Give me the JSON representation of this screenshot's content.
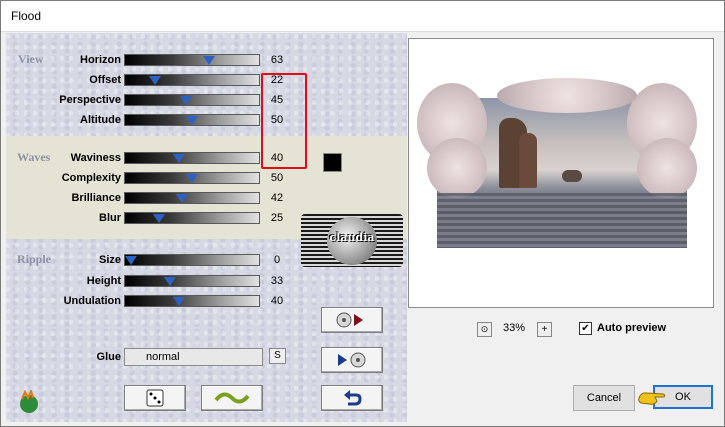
{
  "window": {
    "title": "Flood"
  },
  "sections": {
    "view": "View",
    "waves": "Waves",
    "ripple": "Ripple"
  },
  "view": [
    {
      "label": "Horizon",
      "value": "63"
    },
    {
      "label": "Offset",
      "value": "22"
    },
    {
      "label": "Perspective",
      "value": "45"
    },
    {
      "label": "Altitude",
      "value": "50"
    }
  ],
  "waves": [
    {
      "label": "Waviness",
      "value": "40"
    },
    {
      "label": "Complexity",
      "value": "50"
    },
    {
      "label": "Brilliance",
      "value": "42"
    },
    {
      "label": "Blur",
      "value": "25"
    }
  ],
  "ripple": [
    {
      "label": "Size",
      "value": "0"
    },
    {
      "label": "Height",
      "value": "33"
    },
    {
      "label": "Undulation",
      "value": "40"
    }
  ],
  "glue": {
    "label": "Glue",
    "value": "normal",
    "button": "S"
  },
  "logo": {
    "text": "claudia"
  },
  "zoom": {
    "value": "33%",
    "plus": "+"
  },
  "auto_preview": {
    "label": "Auto preview",
    "checked": true
  },
  "buttons": {
    "cancel": "Cancel",
    "ok": "OK"
  },
  "colors": {
    "waves_color": "#000000",
    "accent": "#2f62c0",
    "highlight": "#e01010"
  }
}
